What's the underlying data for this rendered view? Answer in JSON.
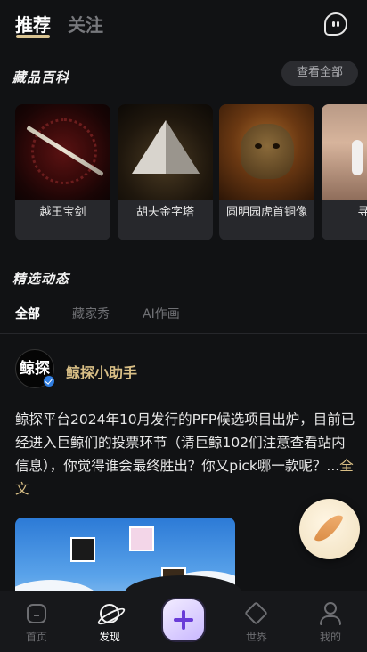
{
  "header": {
    "tabs": [
      {
        "label": "推荐",
        "active": true
      },
      {
        "label": "关注",
        "active": false
      }
    ],
    "message_icon": "message-icon"
  },
  "collection_section": {
    "title": "藏品百科",
    "view_all_label": "查看全部",
    "items": [
      {
        "name": "越王宝剑"
      },
      {
        "name": "胡夫金字塔"
      },
      {
        "name": "圆明园虎首铜像"
      },
      {
        "name": "寻梦"
      }
    ]
  },
  "featured_section": {
    "title": "精选动态",
    "tabs": [
      {
        "label": "全部",
        "active": true
      },
      {
        "label": "藏家秀",
        "active": false
      },
      {
        "label": "AI作画",
        "active": false
      }
    ]
  },
  "post": {
    "avatar_text": "鲸探",
    "author": "鲸探小助手",
    "verified": true,
    "body": "鲸探平台2024年10月发行的PFP候选项目出炉，目前已经进入巨鲸们的投票环节（请巨鲸102们注意查看站内信息），你觉得谁会最终胜出？你又pick哪一款呢？...",
    "more_label": "全文"
  },
  "bottom_nav": {
    "items": [
      {
        "label": "首页",
        "icon": "home-icon",
        "active": false
      },
      {
        "label": "发现",
        "icon": "discover-icon",
        "active": true
      },
      {
        "label": "世界",
        "icon": "world-icon",
        "active": false
      },
      {
        "label": "我的",
        "icon": "profile-icon",
        "active": false
      }
    ],
    "create_icon": "plus-icon"
  },
  "colors": {
    "background": "#111214",
    "accent_gold": "#d9bf86",
    "plus_purple": "#6a3cd8"
  }
}
